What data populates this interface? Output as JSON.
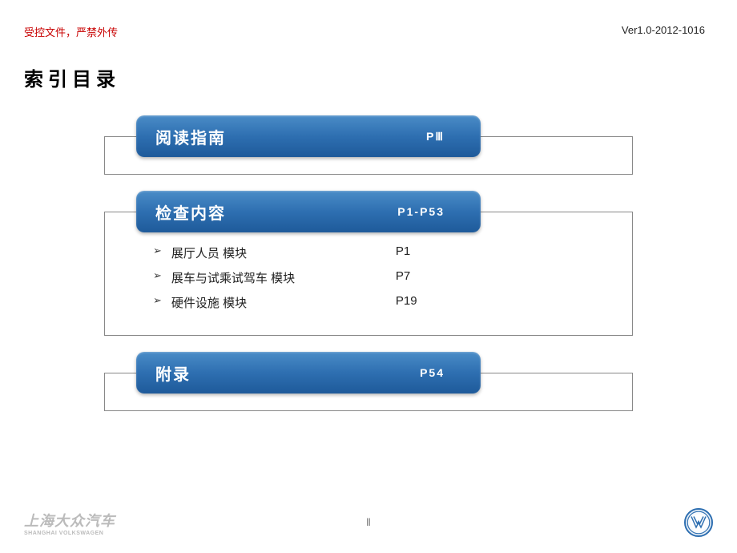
{
  "header": {
    "confidential": "受控文件，严禁外传",
    "version": "Ver1.0-2012-1016"
  },
  "title": "索引目录",
  "sections": [
    {
      "title": "阅读指南",
      "page": "PⅢ",
      "items": []
    },
    {
      "title": "检查内容",
      "page": "P1-P53",
      "items": [
        {
          "label": "展厅人员 模块",
          "page": "P1"
        },
        {
          "label": "展车与试乘试驾车 模块",
          "page": "P7"
        },
        {
          "label": "硬件设施 模块",
          "page": "P19"
        }
      ]
    },
    {
      "title": "附录",
      "page": "P54",
      "items": []
    }
  ],
  "footer": {
    "company_cn": "上海大众汽车",
    "company_en": "SHANGHAI VOLKSWAGEN",
    "page_number": "Ⅱ"
  }
}
